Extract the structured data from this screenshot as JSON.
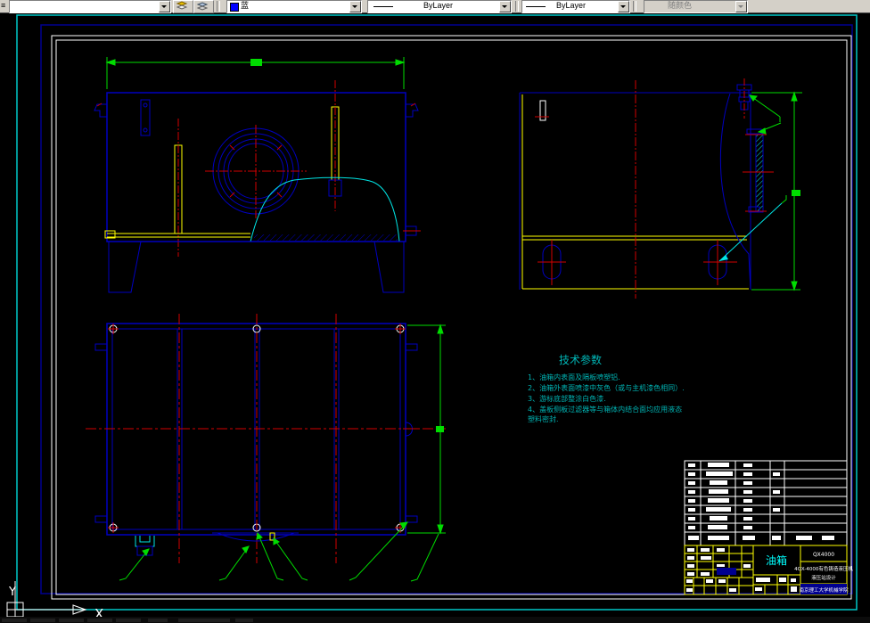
{
  "toolbar": {
    "layer_combo_value": "",
    "color_combo_value": "蓝",
    "linetype_combo_value": "ByLayer",
    "lineweight_combo_value": "ByLayer",
    "plotstyle_combo_value": "随颜色"
  },
  "notes": {
    "title": "技术参数",
    "lines": [
      "1、油箱内表面及隔板喷塑铝.",
      "2、油箱外表面喷漆中灰色（或与主机漆色相同）.",
      "3、游标底部整涂白色漆.",
      "4、盖板侧板过滤器等与箱体内结合面均应用液态",
      "塑料密封."
    ]
  },
  "title_block": {
    "part_name": "油箱",
    "drawing_no": "QX4000",
    "project_line1": "4QX-4000有色铸造液压机",
    "project_line2": "液压站设计",
    "organization": "南京理工大学机械学院"
  },
  "ucs": {
    "x_label": "X",
    "y_label": "Y"
  },
  "colors": {
    "background": "#000000",
    "frame_teal": "#00c8c8",
    "frame_navy": "#000090",
    "sheet_white": "#ffffff",
    "line_navy": "#0000c0",
    "centerline_red": "#d20000",
    "dimension_green": "#00dc00",
    "detail_yellow": "#ffff00",
    "highlight_cyan": "#00e5e5",
    "notes_teal": "#00b4b4",
    "toolbar_gray": "#d4d0c8"
  }
}
